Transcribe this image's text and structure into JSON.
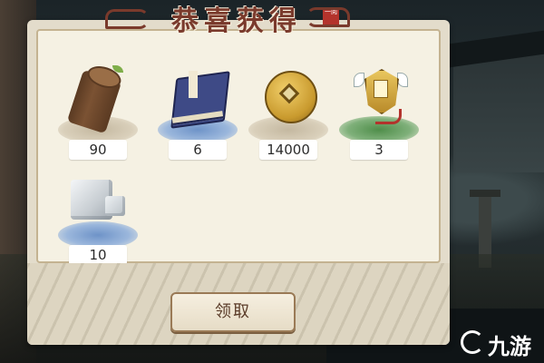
{
  "dialog": {
    "title": "恭喜获得",
    "seal_text": "一阅"
  },
  "rewards": [
    {
      "name": "wood-log",
      "count": "90"
    },
    {
      "name": "skill-book",
      "count": "6"
    },
    {
      "name": "copper-coin",
      "count": "14000"
    },
    {
      "name": "golden-token",
      "count": "3"
    },
    {
      "name": "stone-block",
      "count": "10"
    }
  ],
  "claim_button": {
    "label": "领取"
  },
  "watermark": {
    "text": "九游"
  }
}
